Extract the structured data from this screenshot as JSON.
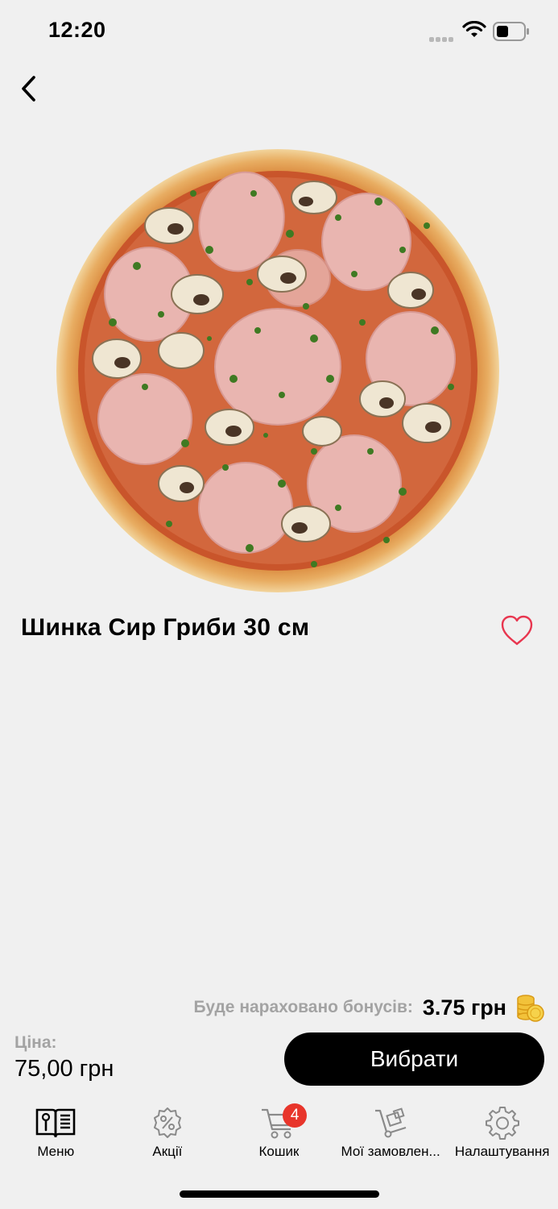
{
  "status_bar": {
    "time": "12:20"
  },
  "product": {
    "title": "Шинка Сир Гриби 30 см",
    "image_icon": "pizza-photo"
  },
  "bonus": {
    "label": "Буде нараховано бонусів:",
    "value": "3.75 грн",
    "icon": "coins-icon"
  },
  "price": {
    "label": "Ціна:",
    "value": "75,00 грн"
  },
  "actions": {
    "choose_label": "Вибрати"
  },
  "tabbar": {
    "items": [
      {
        "label": "Меню",
        "icon": "menu-book-icon"
      },
      {
        "label": "Акції",
        "icon": "discount-icon"
      },
      {
        "label": "Кошик",
        "icon": "cart-icon",
        "badge": "4"
      },
      {
        "label": "Мої замовлен...",
        "icon": "orders-icon"
      },
      {
        "label": "Налаштування",
        "icon": "settings-icon"
      }
    ]
  },
  "colors": {
    "background": "#f0f0f0",
    "accent_heart": "#e8364f",
    "badge": "#e8352b",
    "muted_text": "#a3a3a3"
  }
}
